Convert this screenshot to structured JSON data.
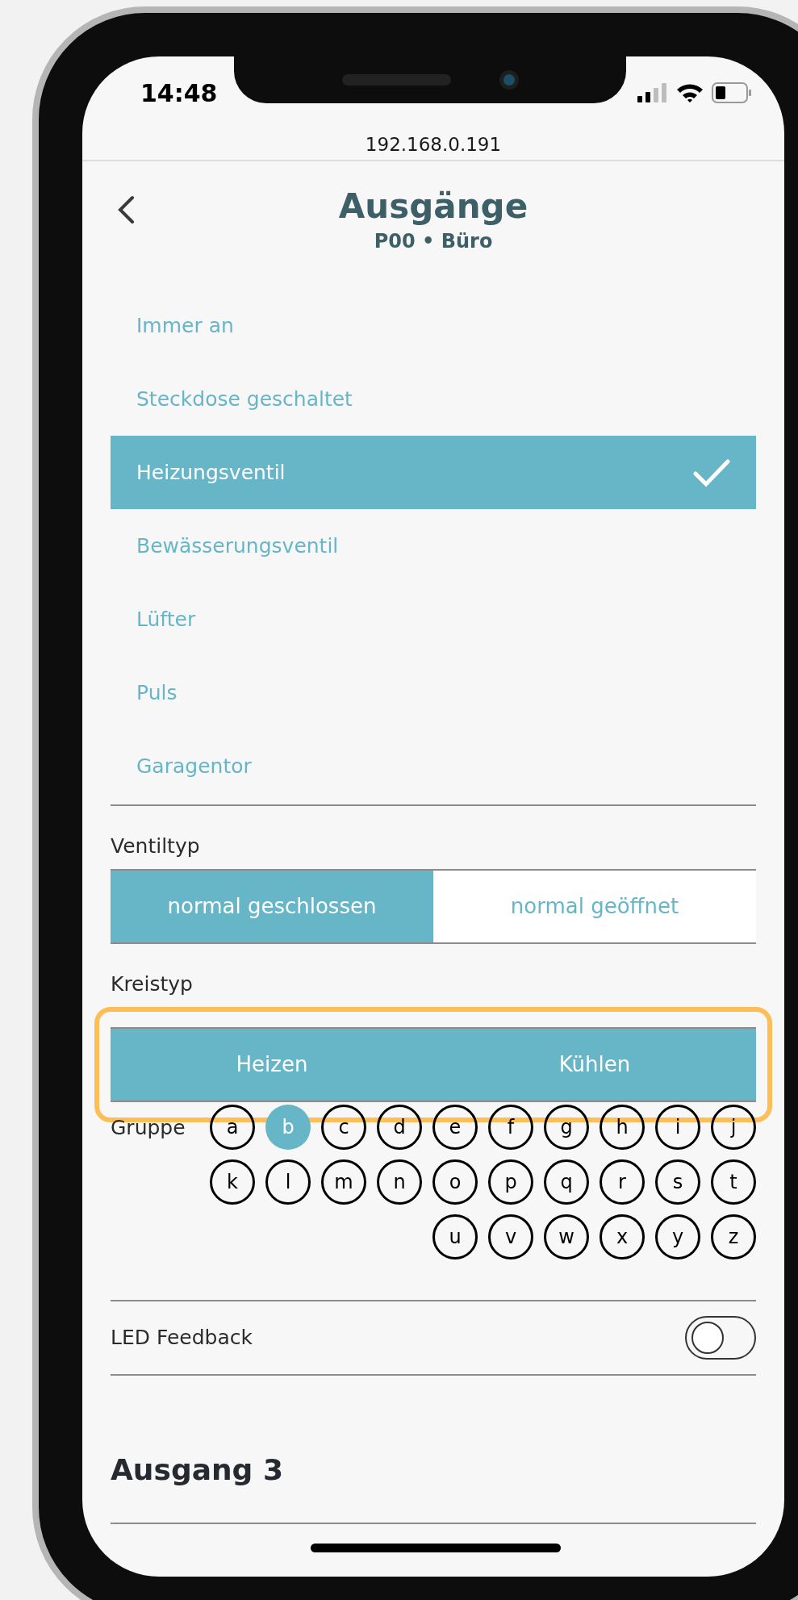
{
  "status_bar": {
    "time": "14:48"
  },
  "browser": {
    "url": "192.168.0.191"
  },
  "header": {
    "title": "Ausgänge",
    "subtitle": "P00 • Büro"
  },
  "options": [
    {
      "label": "Immer an",
      "selected": false
    },
    {
      "label": "Steckdose geschaltet",
      "selected": false
    },
    {
      "label": "Heizungsventil",
      "selected": true
    },
    {
      "label": "Bewässerungsventil",
      "selected": false
    },
    {
      "label": "Lüfter",
      "selected": false
    },
    {
      "label": "Puls",
      "selected": false
    },
    {
      "label": "Garagentor",
      "selected": false
    }
  ],
  "ventiltyp": {
    "label": "Ventiltyp",
    "highlighted": false,
    "segments": [
      {
        "label": "normal geschlossen",
        "selected": true
      },
      {
        "label": "normal geöffnet",
        "selected": false
      }
    ]
  },
  "kreistyp": {
    "label": "Kreistyp",
    "highlighted": true,
    "segments": [
      {
        "label": "Heizen",
        "selected": true
      },
      {
        "label": "Kühlen",
        "selected": true
      }
    ]
  },
  "gruppe": {
    "label": "Gruppe",
    "letters": [
      {
        "label": "a",
        "selected": false
      },
      {
        "label": "b",
        "selected": true
      },
      {
        "label": "c",
        "selected": false
      },
      {
        "label": "d",
        "selected": false
      },
      {
        "label": "e",
        "selected": false
      },
      {
        "label": "f",
        "selected": false
      },
      {
        "label": "g",
        "selected": false
      },
      {
        "label": "h",
        "selected": false
      },
      {
        "label": "i",
        "selected": false
      },
      {
        "label": "j",
        "selected": false
      },
      {
        "label": "k",
        "selected": false
      },
      {
        "label": "l",
        "selected": false
      },
      {
        "label": "m",
        "selected": false
      },
      {
        "label": "n",
        "selected": false
      },
      {
        "label": "o",
        "selected": false
      },
      {
        "label": "p",
        "selected": false
      },
      {
        "label": "q",
        "selected": false
      },
      {
        "label": "r",
        "selected": false
      },
      {
        "label": "s",
        "selected": false
      },
      {
        "label": "t",
        "selected": false
      },
      {
        "label": "u",
        "selected": false
      },
      {
        "label": "v",
        "selected": false
      },
      {
        "label": "w",
        "selected": false
      },
      {
        "label": "x",
        "selected": false
      },
      {
        "label": "y",
        "selected": false
      },
      {
        "label": "z",
        "selected": false
      }
    ]
  },
  "led_feedback": {
    "label": "LED Feedback",
    "on": false
  },
  "next_section": {
    "title": "Ausgang 3"
  }
}
